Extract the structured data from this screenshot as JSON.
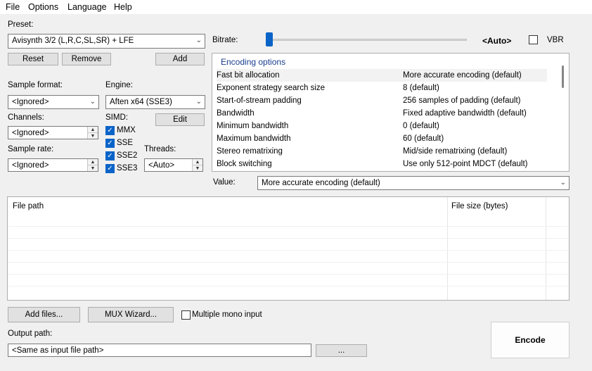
{
  "menu": [
    "File",
    "Options",
    "Language",
    "Help"
  ],
  "preset": {
    "label": "Preset:",
    "value": "Avisynth 3/2 (L,R,C,SL,SR) + LFE",
    "reset": "Reset",
    "remove": "Remove",
    "add": "Add"
  },
  "sample_format": {
    "label": "Sample format:",
    "value": "<Ignored>"
  },
  "engine": {
    "label": "Engine:",
    "value": "Aften x64 (SSE3)",
    "edit": "Edit"
  },
  "channels": {
    "label": "Channels:",
    "value": "<Ignored>"
  },
  "simd": {
    "label": "SIMD:",
    "items": [
      {
        "name": "MMX",
        "checked": true
      },
      {
        "name": "SSE",
        "checked": true
      },
      {
        "name": "SSE2",
        "checked": true
      },
      {
        "name": "SSE3",
        "checked": true
      }
    ]
  },
  "sample_rate": {
    "label": "Sample rate:",
    "value": "<Ignored>"
  },
  "threads": {
    "label": "Threads:",
    "value": "<Auto>"
  },
  "bitrate": {
    "label": "Bitrate:",
    "value": "<Auto>",
    "vbr_label": "VBR",
    "vbr_checked": false
  },
  "encoding_options": {
    "title": "Encoding options",
    "rows": [
      {
        "name": "Fast bit allocation",
        "value": "More accurate encoding (default)"
      },
      {
        "name": "Exponent strategy search size",
        "value": "8 (default)"
      },
      {
        "name": "Start-of-stream padding",
        "value": "256 samples of padding (default)"
      },
      {
        "name": "Bandwidth",
        "value": "Fixed adaptive bandwidth (default)"
      },
      {
        "name": "Minimum bandwidth",
        "value": "0 (default)"
      },
      {
        "name": "Maximum bandwidth",
        "value": "60 (default)"
      },
      {
        "name": "Stereo rematrixing",
        "value": "Mid/side rematrixing (default)"
      },
      {
        "name": "Block switching",
        "value": "Use only 512-point MDCT (default)"
      }
    ]
  },
  "value_field": {
    "label": "Value:",
    "value": "More accurate encoding (default)"
  },
  "file_list": {
    "col_path": "File path",
    "col_size": "File size (bytes)"
  },
  "buttons": {
    "add_files": "Add files...",
    "mux_wizard": "MUX Wizard...",
    "multiple_mono": "Multiple mono input",
    "encode": "Encode",
    "browse": "..."
  },
  "output": {
    "label": "Output path:",
    "value": "<Same as input file path>"
  }
}
